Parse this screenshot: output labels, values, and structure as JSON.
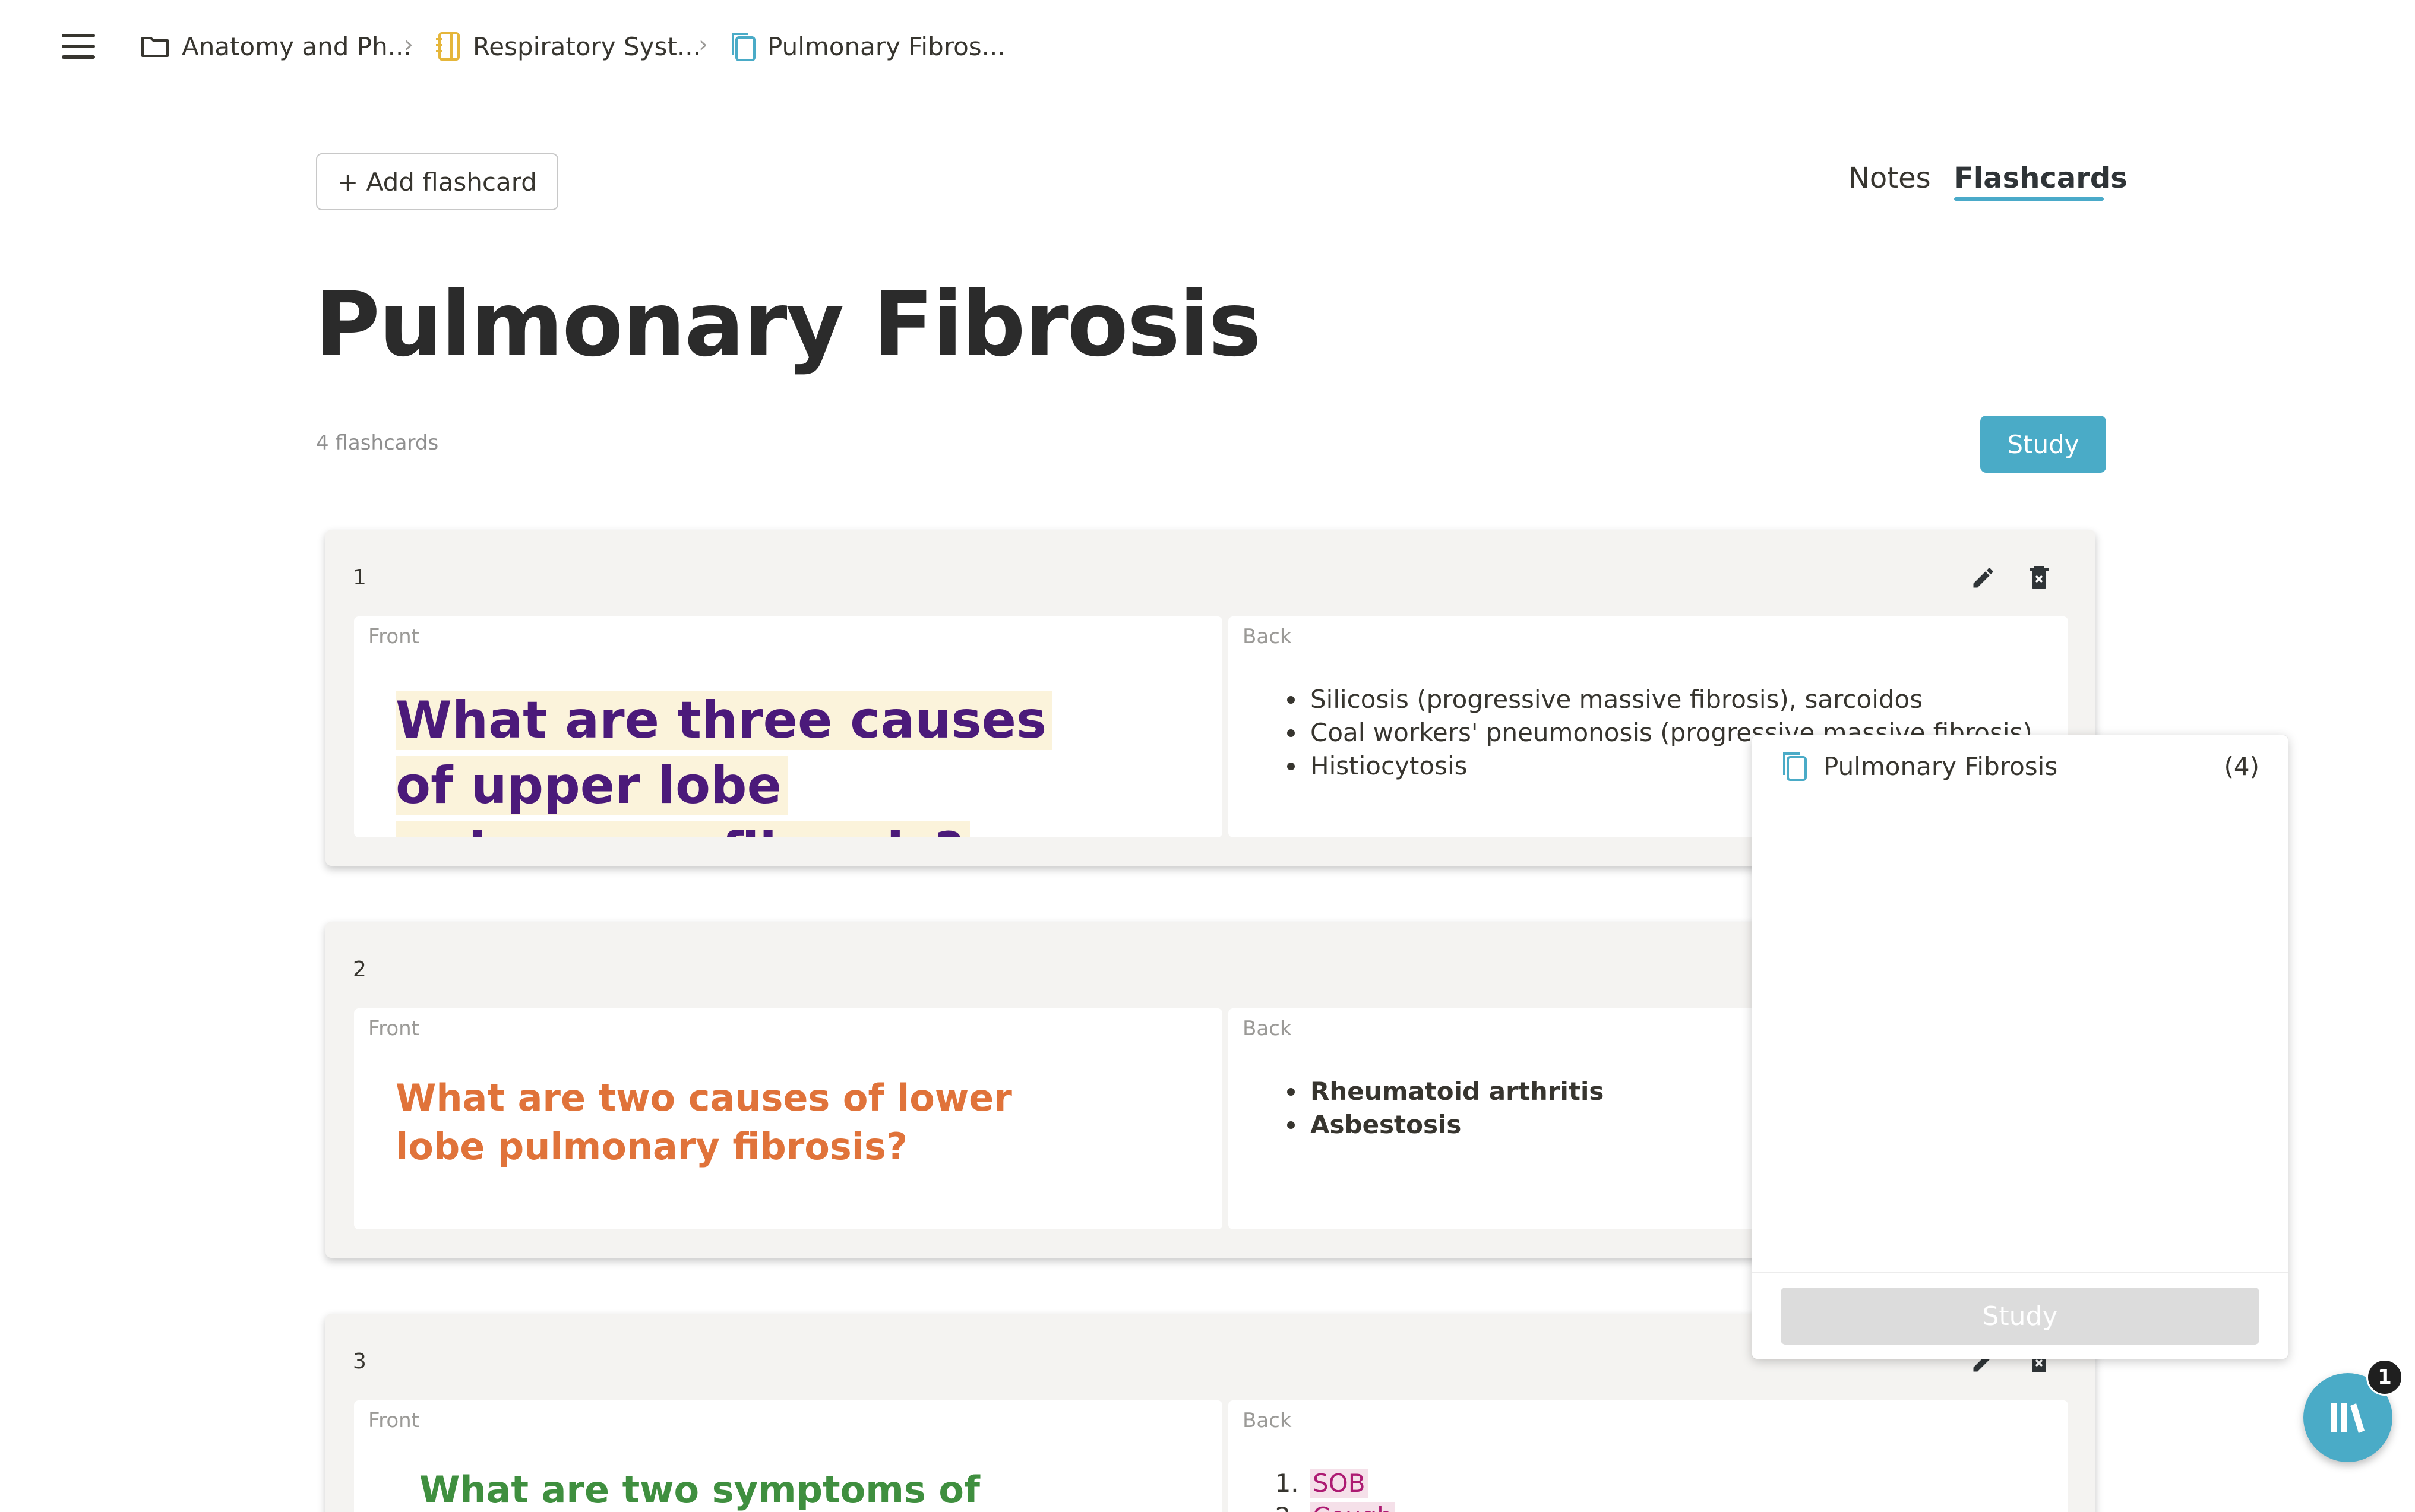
{
  "breadcrumbs": [
    {
      "label": "Anatomy and Ph...",
      "icon": "folder-icon"
    },
    {
      "label": "Respiratory Syst...",
      "icon": "notebook-icon",
      "color": "#e5b63a"
    },
    {
      "label": "Pulmonary Fibros...",
      "icon": "flashcard-deck-icon",
      "color": "#4aabc7"
    }
  ],
  "header": {
    "add_button": "+ Add flashcard",
    "tabs": [
      {
        "label": "Notes",
        "active": false
      },
      {
        "label": "Flashcards",
        "active": true
      }
    ]
  },
  "page": {
    "title": "Pulmonary Fibrosis",
    "count_text": "4 flashcards",
    "study_label": "Study"
  },
  "cards": [
    {
      "number": "1",
      "front_label": "Front",
      "back_label": "Back",
      "front": "What are three causes of upper lobe pulmonary fibrosis?",
      "front_color": "#4b1a7a",
      "front_highlight": "#fbf3db",
      "back_items": [
        "Silicosis (progressive massive fibrosis), sarcoidos",
        "Coal workers' pneumonosis (progressive massive fibrosis)",
        "Histiocytosis"
      ]
    },
    {
      "number": "2",
      "front_label": "Front",
      "back_label": "Back",
      "front": "What are two causes of lower lobe pulmonary fibrosis?",
      "front_color": "#e0733a",
      "back_items": [
        "Rheumatoid arthritis",
        "Asbestosis"
      ]
    },
    {
      "number": "3",
      "front_label": "Front",
      "back_label": "Back",
      "front": "What are two symptoms of pulmonary",
      "front_color": "#3f8f3f",
      "back_items": [
        "SOB",
        "Cough"
      ]
    }
  ],
  "popover": {
    "deck_name": "Pulmonary Fibrosis",
    "deck_count": "(4)",
    "study_label": "Study"
  },
  "fab": {
    "badge": "1",
    "icon": "library-icon"
  },
  "colors": {
    "accent": "#4aabc7",
    "text": "#37352f",
    "card_bg": "#f4f3f1"
  }
}
